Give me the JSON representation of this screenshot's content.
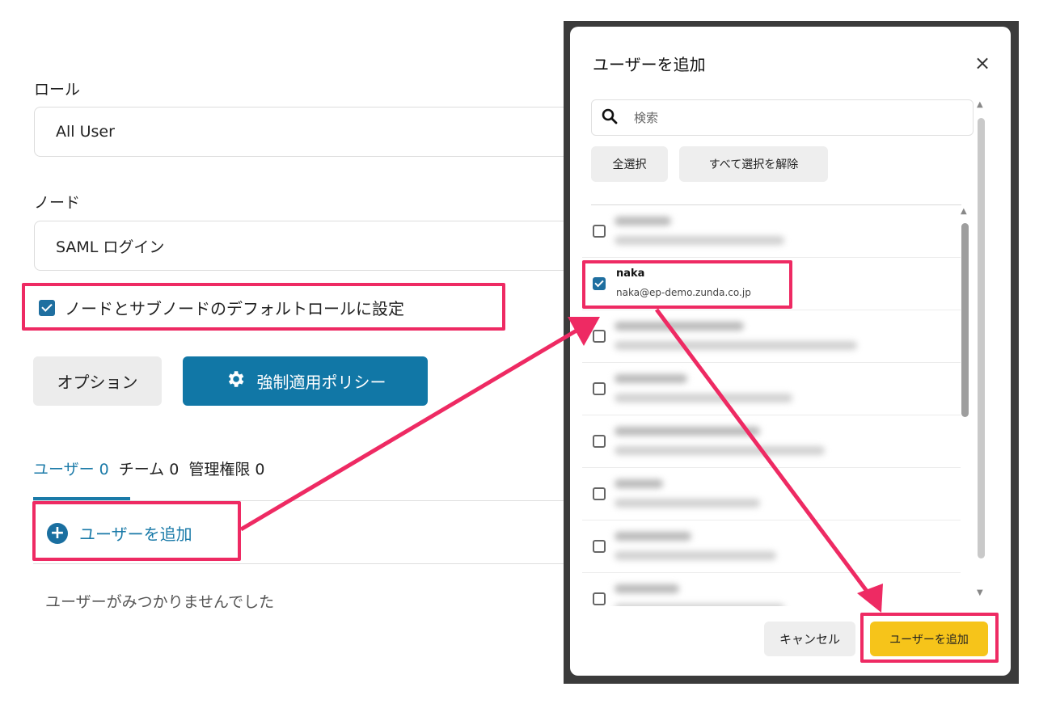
{
  "form": {
    "role_label": "ロール",
    "role_value": "All User",
    "node_label": "ノード",
    "node_value": "SAML ログイン",
    "default_role_checkbox_label": "ノードとサブノードのデフォルトロールに設定",
    "default_role_checked": true,
    "options_button": "オプション",
    "policy_button": "強制適用ポリシー"
  },
  "tabs": [
    {
      "label": "ユーザー 0",
      "active": true
    },
    {
      "label": "チーム 0",
      "active": false
    },
    {
      "label": "管理権限 0",
      "active": false
    }
  ],
  "add_user_link": "ユーザーを追加",
  "empty_message": "ユーザーがみつかりませんでした",
  "dialog": {
    "title": "ユーザーを追加",
    "close_icon": "×",
    "search_placeholder": "検索",
    "select_all": "全選択",
    "deselect_all": "すべて選択を解除",
    "users": [
      {
        "name": "",
        "email": "",
        "checked": false,
        "blurred": true
      },
      {
        "name": "naka",
        "email": "naka@ep-demo.zunda.co.jp",
        "checked": true,
        "blurred": false
      },
      {
        "name": "",
        "email": "",
        "checked": false,
        "blurred": true
      },
      {
        "name": "",
        "email": "",
        "checked": false,
        "blurred": true
      },
      {
        "name": "",
        "email": "",
        "checked": false,
        "blurred": true
      },
      {
        "name": "",
        "email": "",
        "checked": false,
        "blurred": true
      },
      {
        "name": "",
        "email": "",
        "checked": false,
        "blurred": true
      },
      {
        "name": "",
        "email": "",
        "checked": false,
        "blurred": true
      }
    ],
    "cancel_button": "キャンセル",
    "add_button": "ユーザーを追加"
  },
  "colors": {
    "accent": "#1177a6",
    "highlight": "#ee2a63",
    "primary_action": "#f6c41a"
  },
  "icons": {
    "policy": "gear-icon",
    "add_user": "plus-circle-icon",
    "search": "search-icon",
    "close": "close-icon"
  }
}
